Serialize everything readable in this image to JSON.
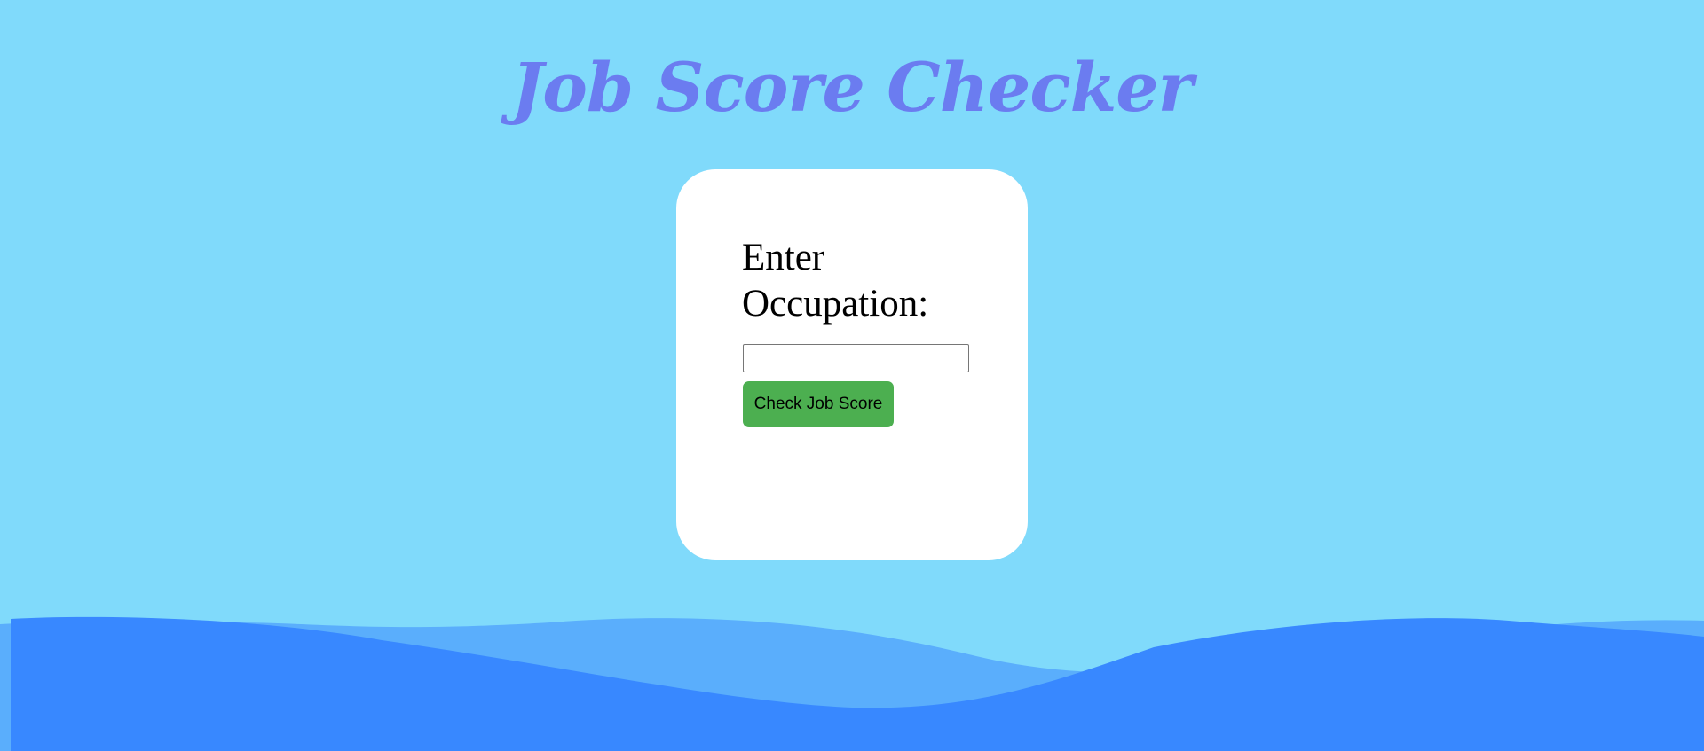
{
  "header": {
    "title": "Job Score Checker"
  },
  "form": {
    "label": "Enter Occupation:",
    "input_value": "",
    "input_placeholder": "",
    "submit_label": "Check Job Score"
  },
  "colors": {
    "background": "#80dafb",
    "title": "#6b7cf0",
    "card": "#ffffff",
    "button": "#4caf50",
    "wave_back": "#5aaefc",
    "wave_front": "#3888ff"
  }
}
